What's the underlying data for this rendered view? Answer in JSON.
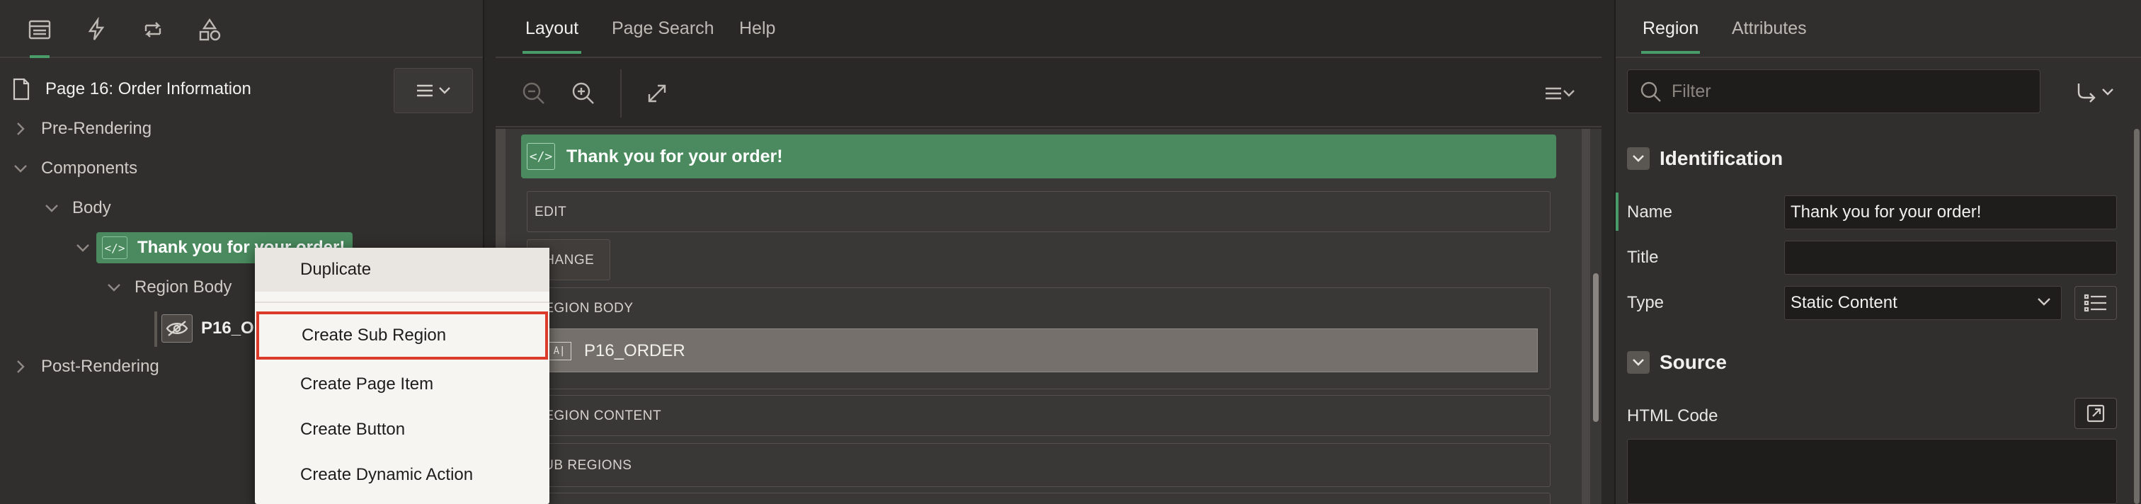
{
  "left_panel": {
    "page_title": "Page 16: Order Information",
    "tree": {
      "pre_rendering": "Pre-Rendering",
      "components": "Components",
      "body": "Body",
      "region": "Thank you for your order!",
      "region_body": "Region Body",
      "item": "P16_ORDER",
      "post_rendering": "Post-Rendering"
    }
  },
  "context_menu": {
    "items": [
      "Duplicate",
      "Create Sub Region",
      "Create Page Item",
      "Create Button",
      "Create Dynamic Action"
    ]
  },
  "center_panel": {
    "tabs": [
      "Layout",
      "Page Search",
      "Help"
    ],
    "region_title": "Thank you for your order!",
    "slots": {
      "edit": "EDIT",
      "change": "CHANGE",
      "region_body": "REGION BODY",
      "item": "P16_ORDER",
      "region_content": "REGION CONTENT",
      "sub_regions": "SUB REGIONS"
    },
    "item_icon_text": "A|"
  },
  "right_panel": {
    "tabs": [
      "Region",
      "Attributes"
    ],
    "filter_placeholder": "Filter",
    "identification": {
      "title": "Identification",
      "name_label": "Name",
      "name_value": "Thank you for your order!",
      "title_label": "Title",
      "title_value": "",
      "type_label": "Type",
      "type_value": "Static Content"
    },
    "source": {
      "title": "Source",
      "html_code_label": "HTML Code"
    }
  },
  "colors": {
    "accent_green": "#4a9b6a",
    "region_green": "#4a8a5e",
    "focus_red": "#dc3b2c"
  }
}
